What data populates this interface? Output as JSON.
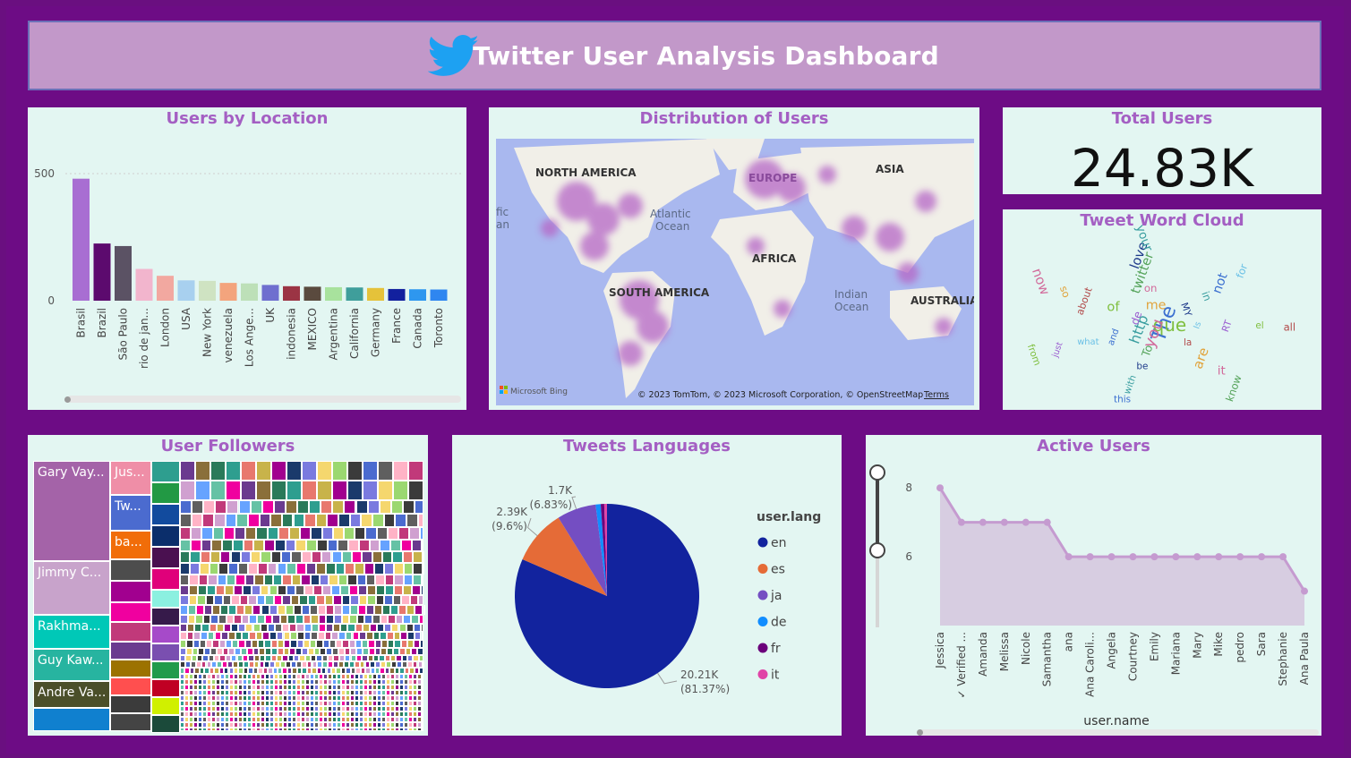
{
  "header": {
    "title": "Twitter User Analysis Dashboard",
    "logo_icon": "twitter-bird-icon",
    "logo_color": "#1da1f2"
  },
  "colors": {
    "background": "#6d0c85",
    "card": "#e3f6f2",
    "title": "#a45fc3",
    "header": "#c298c9"
  },
  "location_chart": {
    "title": "Users by Location",
    "chart_data": {
      "type": "bar",
      "title": "Users by Location",
      "categories": [
        "Brasil",
        "Brazil",
        "São Paulo",
        "rio de jan...",
        "London",
        "USA",
        "New York",
        "venezuela",
        "Los Ange...",
        "UK",
        "indonesia",
        "MEXICO",
        "Argentina",
        "California",
        "Germany",
        "France",
        "Canada",
        "Toronto"
      ],
      "values": [
        480,
        225,
        215,
        125,
        98,
        80,
        78,
        70,
        68,
        62,
        57,
        55,
        53,
        52,
        50,
        46,
        45,
        44
      ],
      "colors": [
        "#a86ed2",
        "#5c0a6e",
        "#5b5264",
        "#f2b5cd",
        "#f2a8a0",
        "#a8d0ef",
        "#cfe3c2",
        "#f3a47d",
        "#bde0b8",
        "#6f6fcf",
        "#9b3444",
        "#5a4a3e",
        "#a8e29d",
        "#3f9e9b",
        "#e5c23a",
        "#12209e",
        "#2e97ef",
        "#2f86f0"
      ],
      "yticks": [
        0,
        500
      ],
      "ylim": [
        0,
        500
      ]
    }
  },
  "map": {
    "title": "Distribution of Users",
    "labels": {
      "north_america": "NORTH AMERICA",
      "europe": "EUROPE",
      "asia": "ASIA",
      "africa": "AFRICA",
      "south_america": "SOUTH AMERICA",
      "australia": "AUSTRALIA",
      "atlantic": "Atlantic\nOcean",
      "indian": "Indian\nOcean",
      "pacific_1": "fic",
      "pacific_2": "an"
    },
    "attribution": "© 2023 TomTom, © 2023 Microsoft Corporation, © OpenStreetMap",
    "terms": "Terms",
    "brand": "Microsoft Bing"
  },
  "total_users": {
    "title": "Total Users",
    "value": "24.83K"
  },
  "word_cloud": {
    "title": "Tweet Word Cloud",
    "words": [
      "The",
      "que",
      "you",
      "http",
      "de",
      "me",
      "MY",
      "Is",
      "la",
      "To",
      "and",
      "of",
      "on",
      "in",
      "RT",
      "are",
      "be",
      "what",
      "about",
      "twitter",
      "not",
      "el",
      "it",
      "with",
      "just",
      "so",
      "love",
      "for",
      "all",
      "know",
      "this",
      "from",
      "now",
      "your"
    ]
  },
  "followers": {
    "title": "User Followers",
    "labels": [
      "Gary Vay...",
      "Jimmy C...",
      "Rakhma...",
      "Guy Kaw...",
      "Andre Va...",
      "Jus...",
      "Tw...",
      "ba..."
    ],
    "colors": [
      "#a463a8",
      "#c8a3cb",
      "#00c8b7",
      "#27b4a0",
      "#4b4f2a",
      "#1080cf",
      "#ef8ea7",
      "#4b6bcf",
      "#f16d09"
    ]
  },
  "languages": {
    "title": "Tweets Languages",
    "legend_title": "user.lang",
    "chart_data": {
      "type": "pie",
      "title": "Tweets Languages",
      "labels": [
        "en",
        "es",
        "ja",
        "de",
        "fr",
        "it"
      ],
      "values": [
        20210,
        2390,
        1700,
        220,
        150,
        120
      ],
      "colors": [
        "#12239e",
        "#e56b37",
        "#744ec2",
        "#118dff",
        "#6b007b",
        "#e044a7"
      ],
      "data_labels": {
        "en": [
          "20.21K",
          "(81.37%)"
        ],
        "es": [
          "2.39K",
          "(9.6%)"
        ],
        "ja": [
          "1.7K",
          "(6.83%)"
        ]
      }
    }
  },
  "active_users": {
    "title": "Active Users",
    "x_label": "user.name",
    "chart_data": {
      "type": "area",
      "title": "Active Users",
      "categories": [
        "Jessica",
        "✓ Verified ...",
        "Amanda",
        "Melissa",
        "Nicole",
        "Samantha",
        "ana",
        "Ana Caroli...",
        "Angela",
        "Courtney",
        "Emily",
        "Mariana",
        "Mary",
        "Mike",
        "pedro",
        "Sara",
        "Stephanie",
        "Ana Paula"
      ],
      "values": [
        8,
        7,
        7,
        7,
        7,
        7,
        6,
        6,
        6,
        6,
        6,
        6,
        6,
        6,
        6,
        6,
        6,
        5
      ],
      "yticks": [
        6,
        8
      ],
      "ylim": [
        4,
        8.5
      ],
      "color": "#c59bd0"
    }
  }
}
